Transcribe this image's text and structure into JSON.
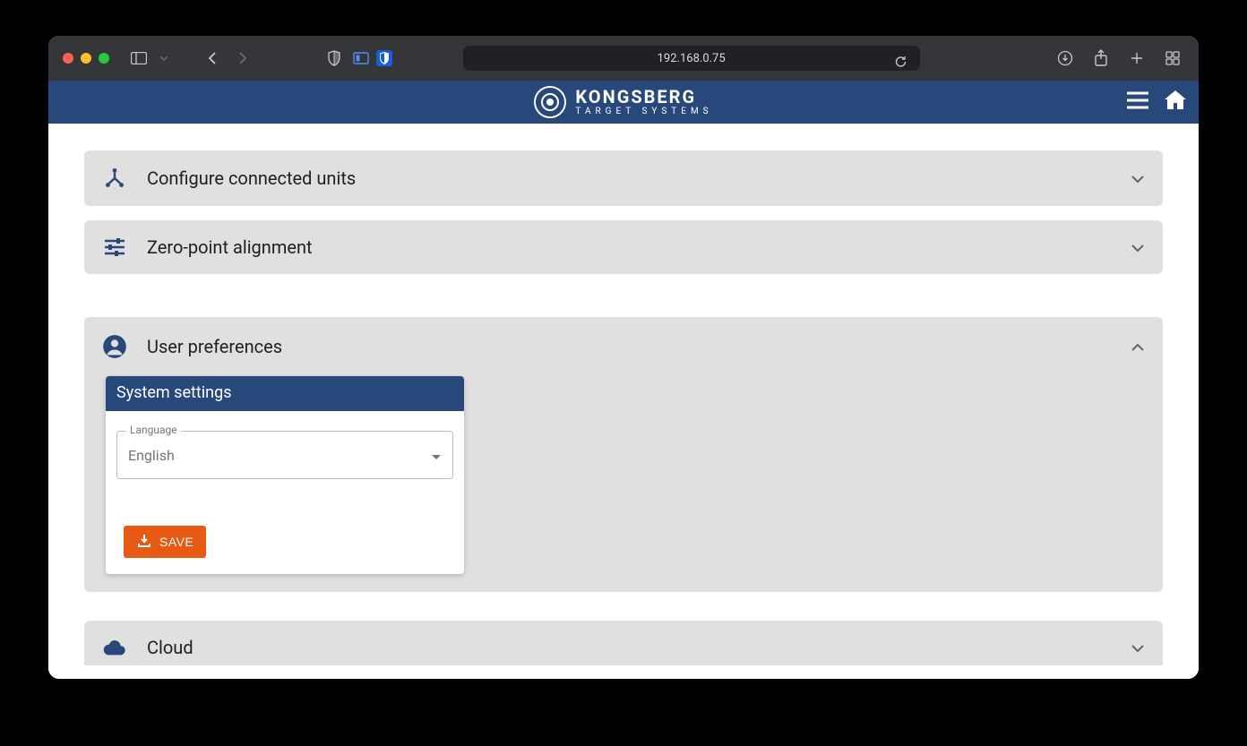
{
  "browser": {
    "url": "192.168.0.75"
  },
  "brand": {
    "main": "KONGSBERG",
    "sub": "TARGET SYSTEMS"
  },
  "panels": {
    "configure": {
      "title": "Configure connected units"
    },
    "zero": {
      "title": "Zero-point alignment"
    },
    "user": {
      "title": "User preferences"
    },
    "cloud": {
      "title": "Cloud"
    }
  },
  "card": {
    "header": "System settings",
    "language_label": "Language",
    "language_value": "English",
    "save_label": "SAVE"
  }
}
